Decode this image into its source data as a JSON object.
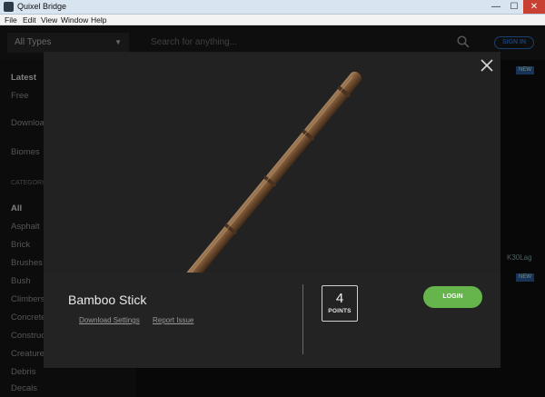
{
  "window": {
    "title": "Quixel Bridge",
    "minimize_glyph": "—",
    "maximize_glyph": "☐",
    "close_glyph": "✕"
  },
  "menu": [
    "File",
    "Edit",
    "View",
    "Window",
    "Help"
  ],
  "topbar": {
    "type_select": "All Types",
    "search_placeholder": "Search for anything...",
    "signin_label": "SIGN IN"
  },
  "sidebar": {
    "items": [
      "Latest",
      "Free",
      "Downloaded",
      "Biomes",
      "CATEGORIES",
      "All",
      "Asphalt",
      "Brick",
      "Brushes",
      "Bush",
      "Climbers",
      "Concrete",
      "Construction",
      "Creatures",
      "Debris",
      "Decals"
    ]
  },
  "background_grid": {
    "new_badge": "NEW",
    "tag": "K30Lag"
  },
  "modal": {
    "asset_name": "Bamboo Stick",
    "links": [
      "Download Settings",
      "Report Issue"
    ],
    "points_value": "4",
    "points_label": "POINTS",
    "login_label": "LOGIN"
  },
  "colors": {
    "accent_green": "#65b54c",
    "accent_blue": "#2e75c9",
    "modal_bg": "#1f1f1f"
  },
  "icons": {
    "search": "search-icon",
    "close": "close-icon"
  }
}
